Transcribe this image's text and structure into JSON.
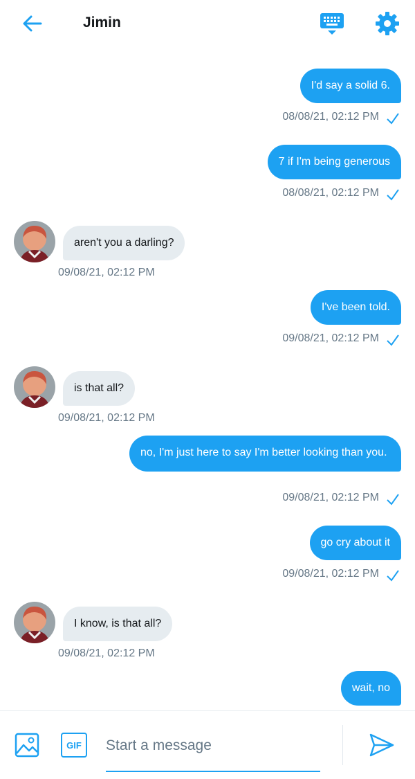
{
  "header": {
    "title": "Jimin",
    "back_icon": "arrow-left-icon",
    "keyboard_icon": "keyboard-icon",
    "settings_icon": "gear-icon"
  },
  "colors": {
    "accent": "#1da1f2",
    "incoming_bubble": "#e6ecf0",
    "timestamp": "#657786"
  },
  "messages": [
    {
      "direction": "out",
      "text": "I'd say a solid 6.",
      "time": "08/08/21, 02:12 PM",
      "read": true
    },
    {
      "direction": "out",
      "text": "7 if I'm being generous",
      "time": "08/08/21, 02:12 PM",
      "read": true
    },
    {
      "direction": "in",
      "text": "aren't you a darling?",
      "time": "09/08/21, 02:12 PM"
    },
    {
      "direction": "out",
      "text": "I've been told.",
      "time": "09/08/21, 02:12 PM",
      "read": true
    },
    {
      "direction": "in",
      "text": "is that all?",
      "time": "09/08/21, 02:12 PM"
    },
    {
      "direction": "out",
      "text": "no, I'm just here to say I'm better looking than you.",
      "time": "09/08/21, 02:12 PM",
      "read": true
    },
    {
      "direction": "out",
      "text": "go cry about it",
      "time": "09/08/21, 02:12 PM",
      "read": true
    },
    {
      "direction": "in",
      "text": "I know, is that all?",
      "time": "09/08/21, 02:12 PM"
    },
    {
      "direction": "out",
      "text": "wait, no"
    }
  ],
  "composer": {
    "placeholder": "Start a message",
    "gif_label": "GIF",
    "image_icon": "image-icon",
    "send_icon": "send-icon"
  }
}
